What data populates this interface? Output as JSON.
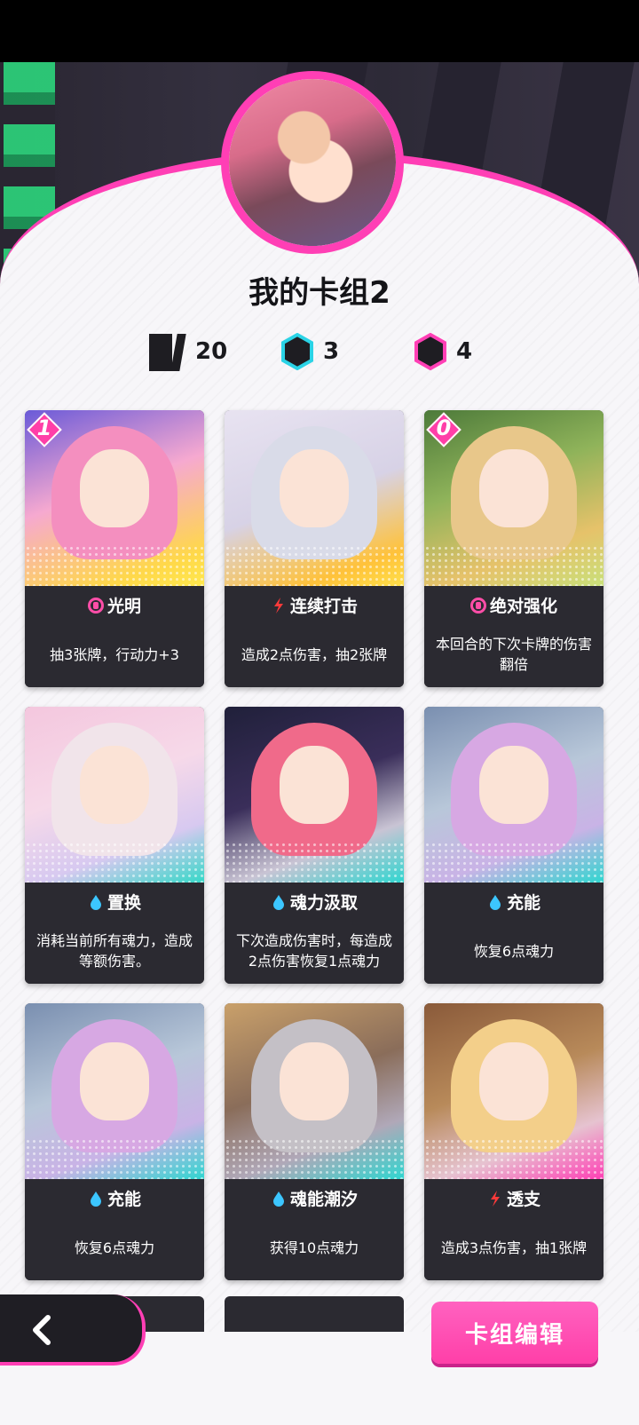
{
  "deck": {
    "title": "我的卡组2",
    "card_count": "20",
    "cyan_count": "3",
    "pink_count": "4"
  },
  "cards": [
    {
      "cost": "1",
      "name": "光明",
      "icon": "shield-icon",
      "desc": "抽3张牌，行动力+3",
      "art": "pink-hair"
    },
    {
      "cost": "",
      "name": "连续打击",
      "icon": "lightning-icon",
      "desc": "造成2点伤害，抽2张牌",
      "art": "silver-hair"
    },
    {
      "cost": "0",
      "name": "绝对强化",
      "icon": "shield-icon",
      "desc": "本回合的下次卡牌的伤害翻倍",
      "art": "blonde-hair"
    },
    {
      "cost": "",
      "name": "置换",
      "icon": "drop-icon",
      "desc": "消耗当前所有魂力，造成等额伤害。",
      "art": "white-hair"
    },
    {
      "cost": "",
      "name": "魂力汲取",
      "icon": "drop-icon",
      "desc": "下次造成伤害时，每造成2点伤害恢复1点魂力",
      "art": "red-hair"
    },
    {
      "cost": "",
      "name": "充能",
      "icon": "drop-icon",
      "desc": "恢复6点魂力",
      "art": "lilac-hair"
    },
    {
      "cost": "",
      "name": "充能",
      "icon": "drop-icon",
      "desc": "恢复6点魂力",
      "art": "lilac-hair"
    },
    {
      "cost": "",
      "name": "魂能潮汐",
      "icon": "drop-icon",
      "desc": "获得10点魂力",
      "art": "grey-hair"
    },
    {
      "cost": "",
      "name": "透支",
      "icon": "lightning-icon",
      "desc": "造成3点伤害，抽1张牌",
      "art": "gold-hair"
    }
  ],
  "buttons": {
    "edit_label": "卡组编辑"
  },
  "colors": {
    "accent": "#ff3fb5",
    "card_bg": "#2b2a31",
    "lightning": "#ff3a3a",
    "drop": "#3cc6ff",
    "cyan_hex": "#2ad3e6",
    "pink_hex": "#ff3fb5"
  }
}
